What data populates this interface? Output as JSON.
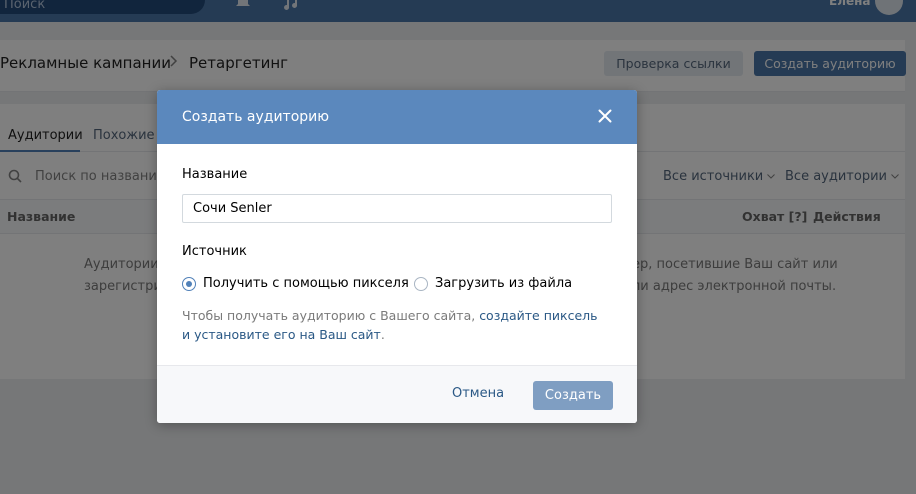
{
  "topbar": {
    "search_placeholder": "Поиск",
    "user_name": "Елена"
  },
  "page": {
    "breadcrumb": [
      "Рекламные кампании",
      "Ретаргетинг"
    ],
    "btn_check": "Проверка ссылки",
    "btn_create": "Создать аудиторию"
  },
  "tabs": [
    "Аудитории",
    "Похожие а"
  ],
  "filters": {
    "search_placeholder": "Поиск по названию",
    "sources": "Все источники",
    "audiences": "Все аудитории"
  },
  "table": {
    "headers": [
      "Название",
      "Охват [?]",
      "Действия"
    ],
    "empty_left": [
      "Аудитории –",
      "зарегистрир"
    ],
    "empty_right": [
      "ер, посетившие Ваш сайт или",
      "ли адрес электронной почты."
    ]
  },
  "modal": {
    "title": "Создать аудиторию",
    "name_label": "Название",
    "name_value": "Сочи Senler",
    "source_label": "Источник",
    "radio_pixel": "Получить с помощью пикселя",
    "radio_file": "Загрузить из файла",
    "selected": "pixel",
    "hint_text": "Чтобы получать аудиторию с Вашего сайта, ",
    "hint_link": "создайте пиксель и установите его на Ваш сайт",
    "hint_end": ".",
    "cancel": "Отмена",
    "submit": "Создать"
  },
  "colors": {
    "header": "#4a76a8",
    "modal_header": "#5b88bd",
    "accent": "#5181b8",
    "link": "#2a5885"
  }
}
